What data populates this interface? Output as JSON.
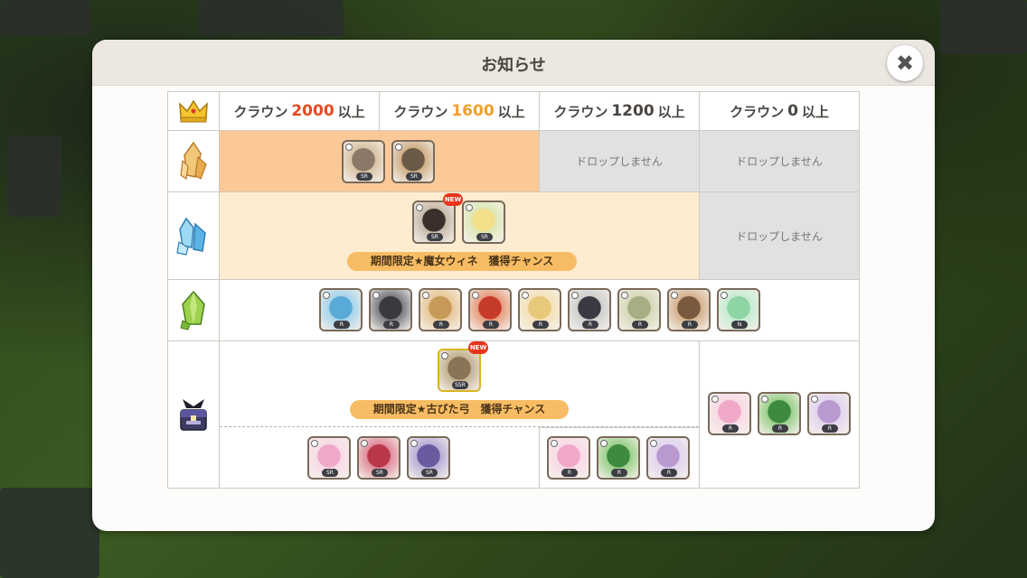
{
  "dialog": {
    "title": "お知らせ",
    "close_icon": "close-icon"
  },
  "table": {
    "header_icon": "crown-icon",
    "columns": [
      {
        "prefix": "クラウン",
        "value": "2000",
        "suffix": "以上",
        "value_color": "#e8481c"
      },
      {
        "prefix": "クラウン",
        "value": "1600",
        "suffix": "以上",
        "value_color": "#f0a028"
      },
      {
        "prefix": "クラウン",
        "value": "1200",
        "suffix": "以上",
        "value_color": "#4a4541"
      },
      {
        "prefix": "クラウン",
        "value": "0",
        "suffix": "以上",
        "value_color": "#4a4541"
      }
    ],
    "rows": [
      {
        "icon": "gold-crystal-icon",
        "items": [
          {
            "name": "character-hooded-girl",
            "rarity": "SR"
          },
          {
            "name": "character-goggle-boy",
            "rarity": "SR"
          }
        ],
        "no_drop_1200": "ドロップしません",
        "no_drop_0": "ドロップしません"
      },
      {
        "icon": "blue-crystal-icon",
        "items": [
          {
            "name": "character-witch-wine",
            "rarity": "SR",
            "new": "NEW"
          },
          {
            "name": "character-blonde-girl",
            "rarity": "SR"
          }
        ],
        "banner": "期間限定★魔女ウィネ　獲得チャンス",
        "no_drop_0": "ドロップしません"
      },
      {
        "icon": "green-crystal-icon",
        "items": [
          {
            "name": "character-blue-bird",
            "rarity": "R"
          },
          {
            "name": "character-dark-knight",
            "rarity": "R"
          },
          {
            "name": "character-brick-golem",
            "rarity": "R"
          },
          {
            "name": "character-red-dragon",
            "rarity": "R"
          },
          {
            "name": "character-blonde-kid",
            "rarity": "R"
          },
          {
            "name": "character-penguin",
            "rarity": "R"
          },
          {
            "name": "character-acorn-robot",
            "rarity": "R"
          },
          {
            "name": "character-brown-boy",
            "rarity": "R"
          },
          {
            "name": "character-green-slime",
            "rarity": "N"
          }
        ]
      },
      {
        "icon": "treasure-chest-icon",
        "top_item": {
          "name": "weapon-old-bow",
          "rarity": "SSR",
          "new": "NEW"
        },
        "banner": "期間限定★古びた弓　獲得チャンス",
        "items_high": [
          {
            "name": "pink-potion",
            "rarity": "SR"
          },
          {
            "name": "red-shell",
            "rarity": "SR"
          },
          {
            "name": "purple-crystal",
            "rarity": "SR"
          }
        ],
        "items_1200": [
          {
            "name": "pink-potion",
            "rarity": "R"
          },
          {
            "name": "green-snake",
            "rarity": "R"
          },
          {
            "name": "lavender-crystal",
            "rarity": "R"
          }
        ],
        "items_0": [
          {
            "name": "pink-potion",
            "rarity": "R"
          },
          {
            "name": "green-snake",
            "rarity": "R"
          },
          {
            "name": "lavender-crystal",
            "rarity": "R"
          }
        ]
      }
    ]
  },
  "colors": {
    "accent_red": "#e8481c",
    "accent_orange": "#f0a028",
    "row_orange": "#fbc997",
    "row_cream": "#fdeccf",
    "no_drop_grey": "#e1e1e1",
    "banner": "#f8bd64"
  }
}
